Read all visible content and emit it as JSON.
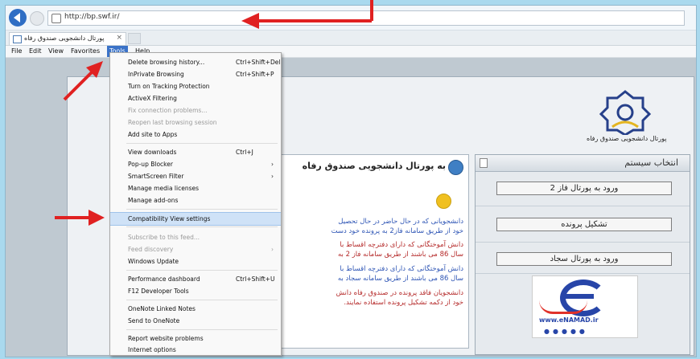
{
  "browser": {
    "url": "http://bp.swf.ir/",
    "tab_label": "پورتال دانشجویی صندوق رفاه",
    "tab_close": "×"
  },
  "menu_bar": {
    "items": [
      {
        "label": "File"
      },
      {
        "label": "Edit"
      },
      {
        "label": "View"
      },
      {
        "label": "Favorites"
      },
      {
        "label": "Tools"
      },
      {
        "label": "Help"
      }
    ]
  },
  "tools_menu": {
    "items": [
      {
        "label": "Delete browsing history...",
        "shortcut": "Ctrl+Shift+Del"
      },
      {
        "label": "InPrivate Browsing",
        "shortcut": "Ctrl+Shift+P"
      },
      {
        "label": "Turn on Tracking Protection",
        "shortcut": ""
      },
      {
        "label": "ActiveX Filtering",
        "shortcut": ""
      },
      {
        "label": "Fix connection problems...",
        "shortcut": "",
        "disabled": true
      },
      {
        "label": "Reopen last browsing session",
        "shortcut": "",
        "disabled": true
      },
      {
        "label": "Add site to Apps",
        "shortcut": ""
      },
      {
        "label": "View downloads",
        "shortcut": "Ctrl+J"
      },
      {
        "label": "Pop-up Blocker",
        "shortcut": "",
        "submenu": true
      },
      {
        "label": "SmartScreen Filter",
        "shortcut": "",
        "submenu": true
      },
      {
        "label": "Manage media licenses",
        "shortcut": ""
      },
      {
        "label": "Manage add-ons",
        "shortcut": ""
      },
      {
        "label": "Compatibility View settings",
        "shortcut": "",
        "highlighted": true
      },
      {
        "label": "Subscribe to this feed...",
        "shortcut": "",
        "disabled": true
      },
      {
        "label": "Feed discovery",
        "shortcut": "",
        "disabled": true,
        "submenu": true
      },
      {
        "label": "Windows Update",
        "shortcut": ""
      },
      {
        "label": "Performance dashboard",
        "shortcut": "Ctrl+Shift+U"
      },
      {
        "label": "F12 Developer Tools",
        "shortcut": ""
      },
      {
        "label": "OneNote Linked Notes",
        "shortcut": ""
      },
      {
        "label": "Send to OneNote",
        "shortcut": ""
      },
      {
        "label": "Report website problems",
        "shortcut": ""
      },
      {
        "label": "Internet options",
        "shortcut": ""
      }
    ],
    "submenu_arrow": "›"
  },
  "page": {
    "logo_caption": "پورتال دانشجویی صندوق رفاه",
    "welcome_title": "به پورتال دانشجویی صندوق رفاه",
    "welcome_lines": [
      {
        "text": "دانشجویانی که در حال حاضر در حال تحصیل",
        "color": "blue"
      },
      {
        "text": "خود از طریق سامانه فاز2 به پرونده خود دست",
        "color": "blue"
      },
      {
        "text": "دانش آموختگانی که دارای دفترچه اقساط با",
        "color": "red"
      },
      {
        "text": "سال 86 می باشند از طریق سامانه فاز 2 به",
        "color": "red"
      },
      {
        "text": "دانش آموختگانی که دارای دفترچه اقساط با",
        "color": "blue"
      },
      {
        "text": "سال 86 می باشند از طریق سامانه سجاد به",
        "color": "blue"
      },
      {
        "text": "دانشجویان فاقد پرونده در صندوق رفاه دانش",
        "color": "red"
      },
      {
        "text": "خود از دکمه تشکیل پرونده استفاده نمایند.",
        "color": "red"
      }
    ],
    "side_panel": {
      "title": "انتخاب سیستم",
      "buttons": [
        {
          "label": "ورود به پورتال فاز 2"
        },
        {
          "label": "تشکیل پرونده"
        },
        {
          "label": "ورود به پورتال سجاد"
        }
      ],
      "enamad_site": "www.eNAMAD.ir",
      "enamad_dots": "●●●●●"
    }
  },
  "colors": {
    "annotation_arrow": "#e02121",
    "menu_active": "#3b73c8",
    "highlight": "#cfe2f7"
  }
}
